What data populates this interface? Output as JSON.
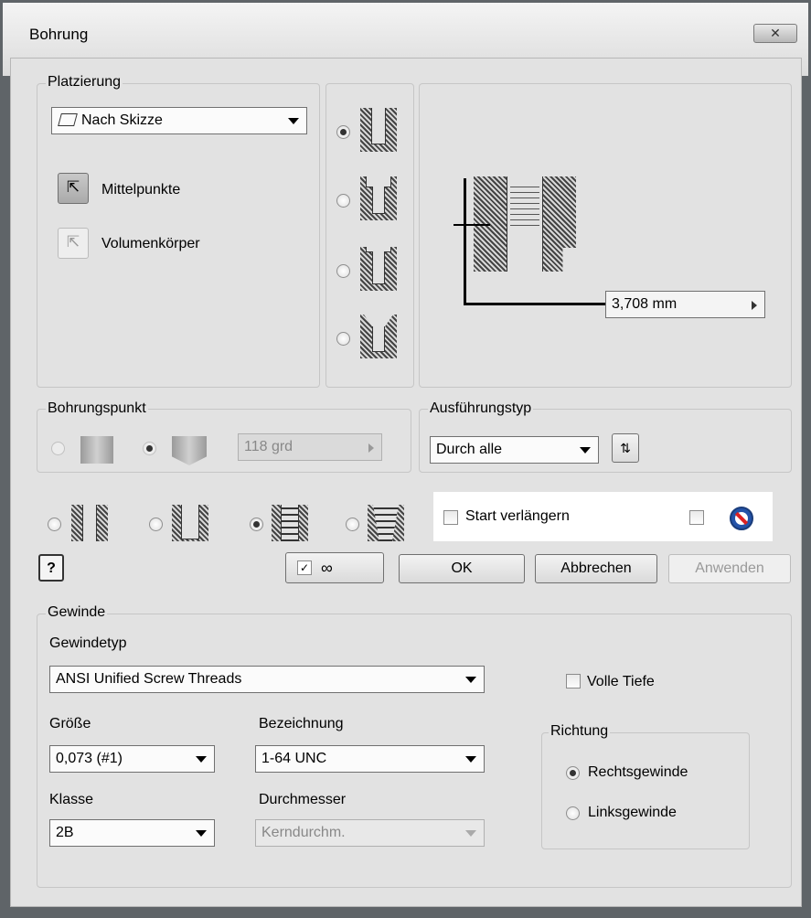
{
  "window": {
    "title": "Bohrung",
    "close_label": "✕"
  },
  "placement": {
    "legend": "Platzierung",
    "dropdown_value": "Nach Skizze",
    "centers_label": "Mittelpunkte",
    "solids_label": "Volumenkörper"
  },
  "preview": {
    "depth_value": "3,708 mm"
  },
  "drill_point": {
    "legend": "Bohrungspunkt",
    "angle_value": "118 grd"
  },
  "termination": {
    "legend": "Ausführungstyp",
    "dropdown_value": "Durch alle"
  },
  "hole_type_options": {
    "start_extend_label": "Start verlängern"
  },
  "buttons": {
    "ok": "OK",
    "cancel": "Abbrechen",
    "apply": "Anwenden",
    "help": "?"
  },
  "thread": {
    "legend": "Gewinde",
    "type_label": "Gewindetyp",
    "type_value": "ANSI Unified Screw Threads",
    "full_depth_label": "Volle Tiefe",
    "size_label": "Größe",
    "size_value": "0,073 (#1)",
    "designation_label": "Bezeichnung",
    "designation_value": "1-64 UNC",
    "class_label": "Klasse",
    "class_value": "2B",
    "diameter_label": "Durchmesser",
    "diameter_value": "Kerndurchm.",
    "direction_legend": "Richtung",
    "right_hand_label": "Rechtsgewinde",
    "left_hand_label": "Linksgewinde"
  }
}
